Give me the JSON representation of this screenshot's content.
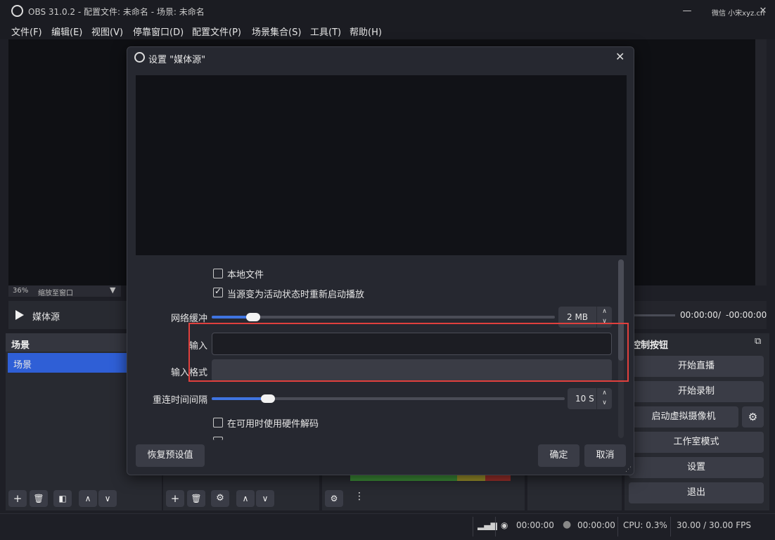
{
  "window": {
    "title": "OBS 31.0.2 - 配置文件: 未命名 - 场景: 未命名",
    "watermark": "微信 小宋xyz.cn",
    "minimize": "—",
    "maximize": "☐",
    "close": "✕"
  },
  "menu": [
    "文件(F)",
    "编辑(E)",
    "视图(V)",
    "停靠窗口(D)",
    "配置文件(P)",
    "场景集合(S)",
    "工具(T)",
    "帮助(H)"
  ],
  "zoom": {
    "percent": "36%",
    "label": "缩放至窗口"
  },
  "source_bar": {
    "name": "媒体源",
    "time_current": "00:00:00",
    "time_sep": "/",
    "time_remaining": "-00:00:00"
  },
  "scenes_dock": {
    "title": "场景",
    "items": [
      "场景"
    ]
  },
  "controls_dock": {
    "title": "控制按钮",
    "buttons": [
      "开始直播",
      "开始录制",
      "启动虚拟摄像机",
      "工作室模式",
      "设置",
      "退出"
    ]
  },
  "status": {
    "stream_time": "00:00:00",
    "rec_time": "00:00:00",
    "cpu": "CPU: 0.3%",
    "fps": "30.00 / 30.00 FPS"
  },
  "dialog": {
    "title": "设置 \"媒体源\"",
    "close": "✕",
    "local_file": "本地文件",
    "restart_on_activate": "当源变为活动状态时重新启动播放",
    "network_buffer_label": "网络缓冲",
    "network_buffer_value": "2 MB",
    "network_buffer_level": 0.12,
    "input_label": "输入",
    "input_value": "",
    "input_format_label": "输入格式",
    "input_format_value": "",
    "reconnect_label": "重连时间间隔",
    "reconnect_value": "10 S",
    "reconnect_level": 0.16,
    "hw_decode": "在可用时使用硬件解码",
    "restore_defaults": "恢复预设值",
    "ok": "确定",
    "cancel": "取消"
  }
}
